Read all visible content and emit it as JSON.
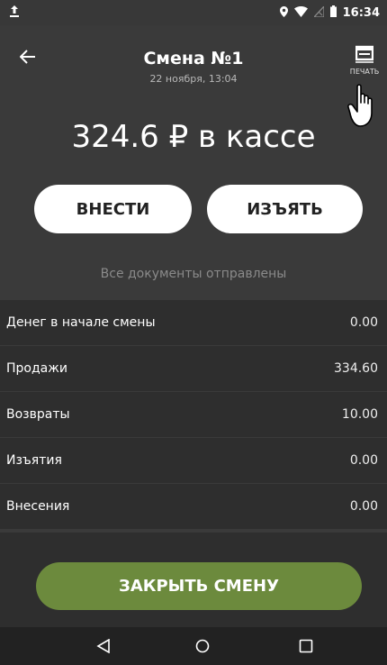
{
  "statusbar": {
    "upload_icon": "upload-icon",
    "time": "16:34"
  },
  "header": {
    "title": "Смена №1",
    "subtitle": "22 ноября, 13:04",
    "print_label": "ПЕЧАТЬ"
  },
  "cash": {
    "amount_text": "324.6 ₽ в кассе"
  },
  "actions": {
    "deposit_label": "ВНЕСТИ",
    "withdraw_label": "ИЗЪЯТЬ"
  },
  "documents_status": "Все документы отправлены",
  "rows": [
    {
      "label": "Денег в начале смены",
      "value": "0.00"
    },
    {
      "label": "Продажи",
      "value": "334.60"
    },
    {
      "label": "Возвраты",
      "value": "10.00"
    },
    {
      "label": "Изъятия",
      "value": "0.00"
    },
    {
      "label": "Внесения",
      "value": "0.00"
    }
  ],
  "close_shift_label": "ЗАКРЫТЬ СМЕНУ",
  "colors": {
    "background": "#3a3a3a",
    "list_bg": "#2e2e2e",
    "accent_green": "#6c8a3d",
    "button_white": "#ffffff"
  }
}
